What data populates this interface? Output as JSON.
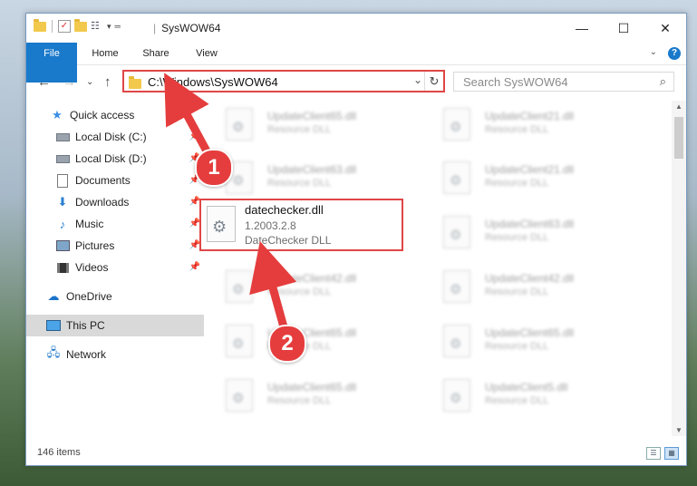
{
  "window": {
    "title": "SysWOW64",
    "controls": {
      "minimize": "—",
      "maximize": "☐",
      "close": "✕"
    }
  },
  "ribbon": {
    "tabs": [
      {
        "label": "File"
      },
      {
        "label": "Home"
      },
      {
        "label": "Share"
      },
      {
        "label": "View"
      }
    ],
    "help": "?"
  },
  "address": {
    "path": "C:\\Windows\\SysWOW64"
  },
  "search": {
    "placeholder": "Search SysWOW64"
  },
  "sidebar": {
    "quick_access": "Quick access",
    "items": [
      {
        "label": "Local Disk (C:)"
      },
      {
        "label": "Local Disk (D:)"
      },
      {
        "label": "Documents"
      },
      {
        "label": "Downloads"
      },
      {
        "label": "Music"
      },
      {
        "label": "Pictures"
      },
      {
        "label": "Videos"
      }
    ],
    "onedrive": "OneDrive",
    "this_pc": "This PC",
    "network": "Network"
  },
  "files": {
    "highlighted": {
      "name": "datechecker.dll",
      "version": "1.2003.2.8",
      "description": "DateChecker DLL"
    },
    "left_column": [
      {
        "name": "UpdateClient65.dll",
        "type": "Resource DLL"
      },
      {
        "name": "UpdateClient63.dll",
        "type": "Resource DLL"
      },
      {
        "name": "UpdateClient42.dll",
        "type": "Resource DLL"
      },
      {
        "name": "UpdateClient65.dll",
        "type": "Resource DLL"
      },
      {
        "name": "UpdateClient65.dll",
        "type": "Resource DLL"
      }
    ],
    "right_column": [
      {
        "name": "UpdateClient21.dll",
        "type": "Resource DLL"
      },
      {
        "name": "UpdateClient21.dll",
        "type": "Resource DLL"
      },
      {
        "name": "UpdateClient63.dll",
        "type": "Resource DLL"
      },
      {
        "name": "UpdateClient42.dll",
        "type": "Resource DLL"
      },
      {
        "name": "UpdateClient65.dll",
        "type": "Resource DLL"
      },
      {
        "name": "UpdateClient5.dll",
        "type": "Resource DLL"
      }
    ]
  },
  "status": {
    "count": "146 items"
  },
  "annotations": {
    "step1": "1",
    "step2": "2",
    "color": "#e53d3d"
  }
}
